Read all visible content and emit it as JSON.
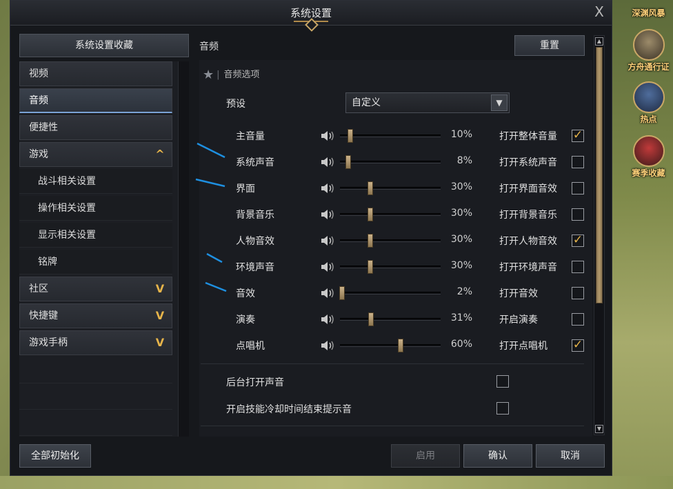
{
  "window": {
    "title": "系统设置",
    "close_label": "X"
  },
  "sidebar": {
    "favorites_label": "系统设置收藏",
    "items": [
      {
        "label": "视频",
        "type": "item"
      },
      {
        "label": "音频",
        "type": "item",
        "active": true
      },
      {
        "label": "便捷性",
        "type": "item"
      },
      {
        "label": "游戏",
        "type": "item",
        "chevron": "^"
      },
      {
        "label": "战斗相关设置",
        "type": "sub"
      },
      {
        "label": "操作相关设置",
        "type": "sub"
      },
      {
        "label": "显示相关设置",
        "type": "sub"
      },
      {
        "label": "铭牌",
        "type": "sub"
      },
      {
        "label": "社区",
        "type": "item",
        "chevron": "V"
      },
      {
        "label": "快捷键",
        "type": "item",
        "chevron": "V"
      },
      {
        "label": "游戏手柄",
        "type": "item",
        "chevron": "V"
      }
    ]
  },
  "main": {
    "section_title": "音频",
    "reset_label": "重置",
    "options_header": "音频选项",
    "preset": {
      "label": "预设",
      "value": "自定义"
    },
    "sliders": [
      {
        "label": "主音量",
        "percent": 10,
        "value_text": "10%",
        "toggle_label": "打开整体音量",
        "checked": true
      },
      {
        "label": "系统声音",
        "percent": 8,
        "value_text": "8%",
        "toggle_label": "打开系统声音",
        "checked": false
      },
      {
        "label": "界面",
        "percent": 30,
        "value_text": "30%",
        "toggle_label": "打开界面音效",
        "checked": false
      },
      {
        "label": "背景音乐",
        "percent": 30,
        "value_text": "30%",
        "toggle_label": "打开背景音乐",
        "checked": false
      },
      {
        "label": "人物音效",
        "percent": 30,
        "value_text": "30%",
        "toggle_label": "打开人物音效",
        "checked": true
      },
      {
        "label": "环境声音",
        "percent": 30,
        "value_text": "30%",
        "toggle_label": "打开环境声音",
        "checked": false
      },
      {
        "label": "音效",
        "percent": 2,
        "value_text": "2%",
        "toggle_label": "打开音效",
        "checked": false
      },
      {
        "label": "演奏",
        "percent": 31,
        "value_text": "31%",
        "toggle_label": "开启演奏",
        "checked": false
      },
      {
        "label": "点唱机",
        "percent": 60,
        "value_text": "60%",
        "toggle_label": "打开点唱机",
        "checked": true
      }
    ],
    "extras": [
      {
        "label": "后台打开声音",
        "checked": false
      },
      {
        "label": "开启技能冷却时间结束提示音",
        "checked": false
      }
    ]
  },
  "footer": {
    "reset_all_label": "全部初始化",
    "apply_label": "启用",
    "confirm_label": "确认",
    "cancel_label": "取消"
  },
  "side_menu": [
    {
      "label": "深渊风暴",
      "icon": "storm-icon"
    },
    {
      "label": "方舟通行证",
      "icon": "ark-pass-icon"
    },
    {
      "label": "热点",
      "icon": "hotspot-icon"
    },
    {
      "label": "赛季收藏",
      "icon": "season-collection-icon"
    }
  ],
  "colors": {
    "accent_gold": "#e6b44a",
    "active_blue": "#7aa3d6",
    "window_bg": "#16181c"
  }
}
